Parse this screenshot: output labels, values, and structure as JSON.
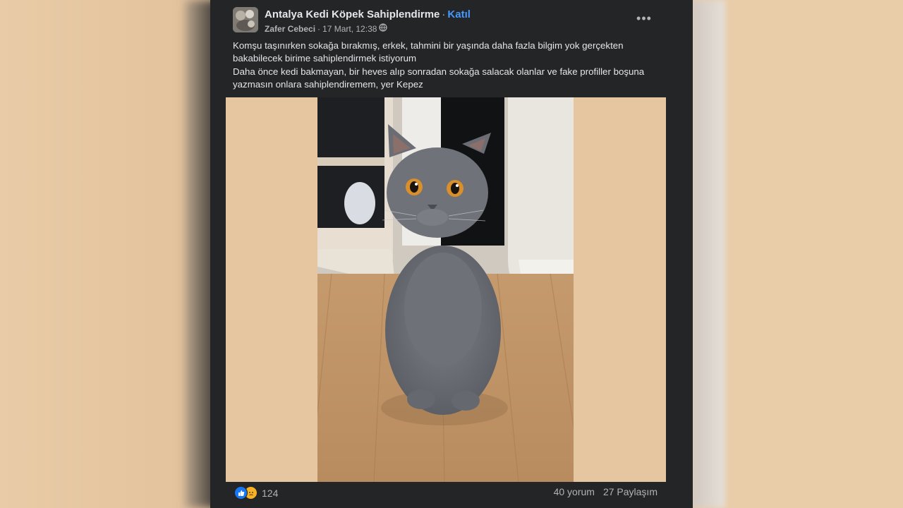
{
  "post": {
    "group_name": "Antalya Kedi Köpek Sahiplendirme",
    "separator": "·",
    "join_label": "Katıl",
    "author": "Zafer Cebeci",
    "date_separator": "·",
    "date": "17 Mart, 12:38",
    "more_label": "•••",
    "text_lines": [
      "Komşu taşınırken sokağa bırakmış, erkek, tahmini bir yaşında daha fazla bilgim yok gerçekten bakabilecek birime sahiplendirmek istiyorum",
      "Daha önce kedi bakmayan, bir heves alıp sonradan sokağa salacak olanlar ve fake profiller boşuna yazmasın onlara sahiplendiremem, yer Kepez"
    ],
    "reaction_count": "124",
    "comments": "40 yorum",
    "shares": "27 Paylaşım"
  },
  "icons": {
    "group_avatar": "group-avatar",
    "privacy": "globe-icon",
    "more": "more-options-icon",
    "like": "like-reaction-icon",
    "sad": "sad-reaction-icon"
  },
  "colors": {
    "card": "#242526",
    "text": "#e4e6eb",
    "secondary": "#b0b3b8",
    "join": "#4599ff",
    "like": "#1877f2",
    "sad": "#f7b125"
  }
}
